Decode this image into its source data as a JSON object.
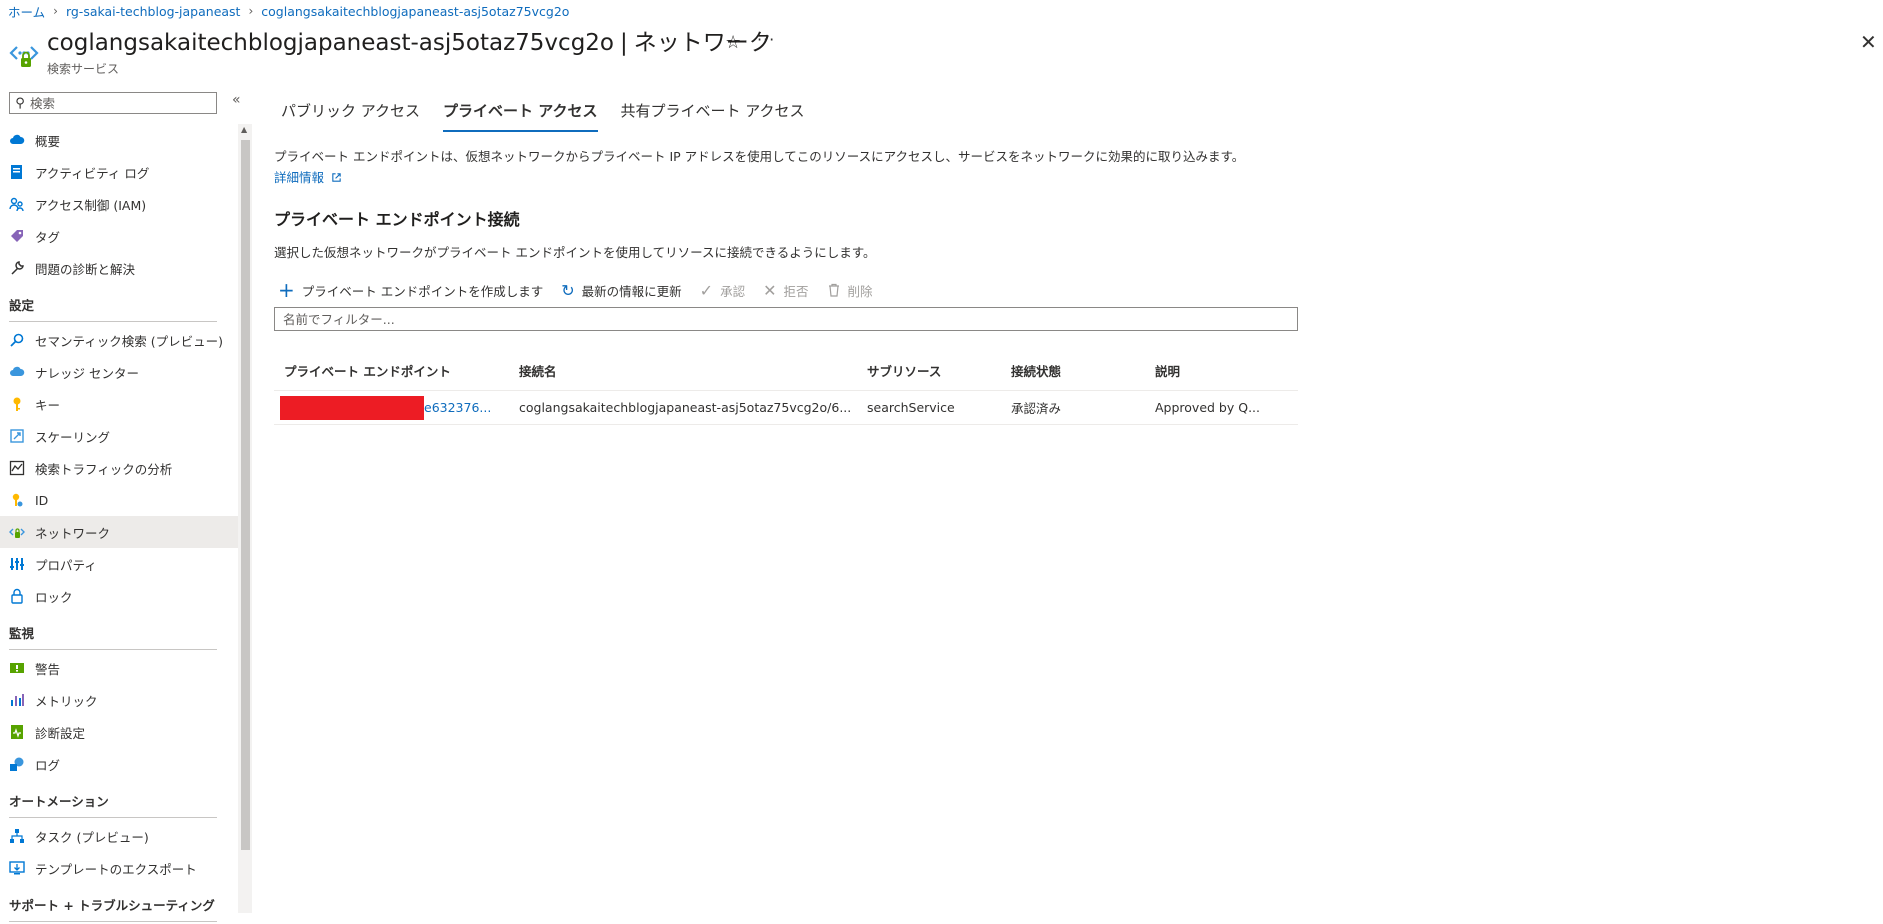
{
  "breadcrumb": [
    "ホーム",
    "rg-sakai-techblog-japaneast",
    "coglangsakaitechblogjapaneast-asj5otaz75vcg2o"
  ],
  "title": {
    "resource_name": "coglangsakaitechblogjapaneast-asj5otaz75vcg2o",
    "pipe": "|",
    "page": "ネットワーク",
    "subtitle": "検索サービス"
  },
  "sidebar": {
    "search_placeholder": "検索",
    "items": [
      {
        "label": "概要",
        "icon": "cloud-icon"
      },
      {
        "label": "アクティビティ ログ",
        "icon": "log-icon"
      },
      {
        "label": "アクセス制御 (IAM)",
        "icon": "people-icon"
      },
      {
        "label": "タグ",
        "icon": "tag-icon"
      },
      {
        "label": "問題の診断と解決",
        "icon": "wrench-icon"
      }
    ],
    "settings_header": "設定",
    "settings_items": [
      {
        "label": "セマンティック検索 (プレビュー)",
        "icon": "search-icon"
      },
      {
        "label": "ナレッジ センター",
        "icon": "cloud-icon"
      },
      {
        "label": "キー",
        "icon": "key-icon"
      },
      {
        "label": "スケーリング",
        "icon": "scale-icon"
      },
      {
        "label": "検索トラフィックの分析",
        "icon": "chart-icon"
      },
      {
        "label": "ID",
        "icon": "identity-icon"
      },
      {
        "label": "ネットワーク",
        "icon": "network-icon"
      },
      {
        "label": "プロパティ",
        "icon": "properties-icon"
      },
      {
        "label": "ロック",
        "icon": "lock-icon"
      }
    ],
    "monitoring_header": "監視",
    "monitoring_items": [
      {
        "label": "警告",
        "icon": "alert-icon"
      },
      {
        "label": "メトリック",
        "icon": "metrics-icon"
      },
      {
        "label": "診断設定",
        "icon": "diagnostic-icon"
      },
      {
        "label": "ログ",
        "icon": "logs-icon"
      }
    ],
    "automation_header": "オートメーション",
    "automation_items": [
      {
        "label": "タスク (プレビュー)",
        "icon": "tasks-icon"
      },
      {
        "label": "テンプレートのエクスポート",
        "icon": "export-icon"
      }
    ],
    "support_header": "サポート + トラブルシューティング"
  },
  "tabs": [
    "パブリック アクセス",
    "プライベート アクセス",
    "共有プライベート アクセス"
  ],
  "main": {
    "description": "プライベート エンドポイントは、仮想ネットワークからプライベート IP アドレスを使用してこのリソースにアクセスし、サービスをネットワークに効果的に取り込みます。",
    "learn_more": "詳細情報",
    "section_title": "プライベート エンドポイント接続",
    "section_desc": "選択した仮想ネットワークがプライベート エンドポイントを使用してリソースに接続できるようにします。",
    "toolbar": {
      "create": "プライベート エンドポイントを作成します",
      "refresh": "最新の情報に更新",
      "approve": "承認",
      "reject": "拒否",
      "delete": "削除"
    },
    "filter_placeholder": "名前でフィルター..."
  },
  "table": {
    "headers": [
      "プライベート エンドポイント",
      "接続名",
      "サブリソース",
      "接続状態",
      "説明"
    ],
    "rows": [
      {
        "endpoint": "e632376...",
        "connection": "coglangsakaitechblogjapaneast-asj5otaz75vcg2o/6...",
        "subresource": "searchService",
        "state": "承認済み",
        "description": "Approved by Q..."
      }
    ]
  },
  "colors": {
    "link": "#0f6cbd",
    "redaction": "#ed1c24",
    "active_nav": "#edebe9"
  }
}
